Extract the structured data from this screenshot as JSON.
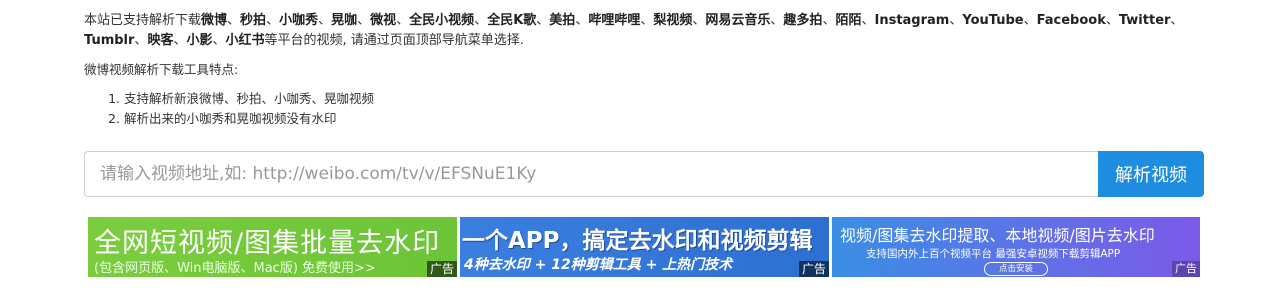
{
  "intro": {
    "prefix": "本站已支持解析下载",
    "platforms": [
      "微博",
      "秒拍",
      "小咖秀",
      "晃咖",
      "微视",
      "全民小视频",
      "全民K歌",
      "美拍",
      "哔哩哔哩",
      "梨视频",
      "网易云音乐",
      "趣多拍",
      "陌陌",
      "Instagram",
      "YouTube",
      "Facebook",
      "Twitter",
      "Tumblr",
      "映客",
      "小影",
      "小红书"
    ],
    "separator": "、",
    "suffix": "等平台的视频, 请通过页面顶部导航菜单选择."
  },
  "features": {
    "title": "微博视频解析下载工具特点:",
    "items": [
      "支持解析新浪微博、秒拍、小咖秀、晃咖视频",
      "解析出来的小咖秀和晃咖视频没有水印"
    ]
  },
  "search": {
    "placeholder": "请输入视频地址,如: http://weibo.com/tv/v/EFSNuE1Ky",
    "value": "",
    "button_label": "解析视频"
  },
  "ads": [
    {
      "headline": "全网短视频/图集批量去水印",
      "sub": "(包含网页版、Win电脑版、Mac版) 免费使用>>",
      "tag": "广告"
    },
    {
      "headline": "一个APP，搞定去水印和视频剪辑",
      "sub": "4种去水印 + 12种剪辑工具 + 上热门技术",
      "tag": "广告"
    },
    {
      "headline": "视频/图集去水印提取、本地视频/图片去水印",
      "sub": "支持国内外上百个视频平台   最强安卓视频下载剪辑APP",
      "button": "点击安装",
      "tag": "广告"
    }
  ],
  "colors": {
    "accent": "#1e8de0",
    "ad1": "#7bcd3e",
    "ad2": "#3a7fe0",
    "ad3": "#6a6ee8"
  }
}
